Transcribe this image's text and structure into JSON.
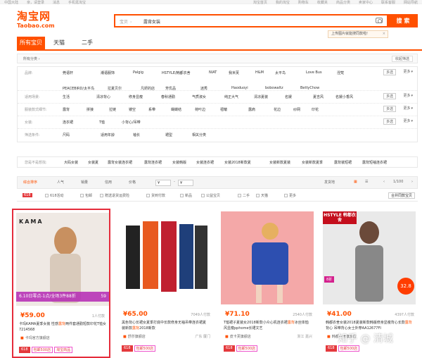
{
  "topbar": [
    "中国大陆",
    "亲，请登录",
    "消息",
    "手机逛淘宝",
    "",
    "淘宝首页",
    "我的淘宝",
    "购物车",
    "收藏夹",
    "商品分类",
    "卖家中心",
    "联系客服",
    "网站导航"
  ],
  "logo": {
    "cn": "淘宝网",
    "en": "Taobao.com"
  },
  "search": {
    "category": "宝贝",
    "query": "露背女装",
    "button": "搜 索",
    "camera": "camera-icon",
    "tip": "上传图片就能搜同款啦!",
    "tip_close": "×"
  },
  "tabs": [
    "所有宝贝",
    "天猫",
    "二手"
  ],
  "crumb": "所有分类",
  "collapse": "收起筛选",
  "filters": [
    {
      "label": "品牌:",
      "values": [
        "莞语轩",
        "潮语服饰",
        "Palgig",
        "HSTYLE/韩都衣舍",
        "NIAT",
        "我米芙",
        "H&M",
        "太平鸟",
        "Love Bus",
        "涅梵",
        "PEACEBIRD/太平鸟",
        "拉夏贝尔",
        "凡妍的店",
        "芳优品",
        "迷秀",
        "Haoduoyi",
        "bobowaltz",
        "BettyChow"
      ],
      "multi": "多选",
      "more": "更多"
    },
    {
      "label": "适用场景:",
      "values": [
        "生活",
        "清凉背心",
        "修身显瘦",
        "春秋通勤",
        "气质淑女",
        "纯正大气",
        "清凉夏装",
        "名媛",
        "夏吉风",
        "名媛小香风"
      ],
      "multi": "多选",
      "more": "更多"
    },
    {
      "label": "服装款式细节:",
      "values": [
        "露背",
        "拼接",
        "拉链",
        "镂空",
        "系带",
        "蝴蝶结",
        "荷叶边",
        "褶皱",
        "露肩",
        "花边",
        "纱网",
        "印花"
      ],
      "multi": "多选",
      "more": "更多"
    },
    {
      "label": "女装:",
      "values": [
        "连衣裙",
        "T恤",
        "小背心/吊带"
      ],
      "multi": "多选",
      "more": "更多"
    },
    {
      "label": "筛选条件:",
      "values": [
        "尺码",
        "适用年龄",
        "袖长",
        "裙型",
        "相关分类"
      ]
    }
  ],
  "guess": {
    "label": "您是不是想找:",
    "values": [
      "大码女装",
      "女装夏",
      "露背女装连衣裙",
      "露背连衣裙",
      "女装韩版",
      "女装连衣裙",
      "女装2018新款夏",
      "女装新款夏装",
      "女装新款夏季",
      "露背装短裙",
      "露背短袖连衣裙",
      "露背",
      "外贸女装",
      "精品女装"
    ]
  },
  "sort": {
    "items": [
      "综合排序",
      "人气",
      "销量",
      "信用",
      "价格"
    ],
    "price_from": "¥",
    "price_to": "¥",
    "ship": "发货地",
    "pages": "1/100"
  },
  "opts": {
    "badge": "618",
    "items": [
      "618活动",
      "包邮",
      "赠送退货运费险",
      "货到付款",
      "新品",
      "公益宝贝",
      "二手",
      "天猫",
      "更多"
    ],
    "ship_to": "合并同款宝贝"
  },
  "products": [
    {
      "brand": "KAMA",
      "price": "¥59.00",
      "sold": "1人付款",
      "title_pre": "卡玛KAMA夏季女装 性感",
      "title_hi": "露背",
      "title_post": "两件套通勤短款印花T恤女 7214568",
      "promo": "6.10日零点-1点/全场3件88折",
      "promo_price": "59",
      "shop": "卡玛官方旗舰店",
      "loc": "",
      "tags": [
        "618",
        "包邮500店",
        "淘宝商品"
      ]
    },
    {
      "price": "¥65.00",
      "sold": "7049人付款",
      "title_pre": "黑色背心长裙女夏季打底中长款修身无袖吊带连衣裙夏装新款",
      "title_hi": "露背",
      "title_post": "2018新款",
      "shop": "舒莎旗舰店",
      "loc": "广东 厦门",
      "tags": [
        "618",
        "包邮500店"
      ]
    },
    {
      "price": "¥71.10",
      "sold": "2540人付款",
      "title_pre": "T恤裙子夏装女2018新款小众心机连衣裙",
      "title_hi": "露背",
      "title_post": "冰丝体恤风显瘦pphome长裙文艺",
      "shop": "皮卡芙旗舰店",
      "loc": "浙江 嘉兴",
      "tags": [
        "618",
        "包邮500店"
      ]
    },
    {
      "brand": "HSTYLE 韩都衣舍",
      "price": "¥41.00",
      "sold": "4397人付款",
      "title_pre": "韩都衣舍女装2018夏装新款韩版修身显瘦背心长款",
      "title_hi": "露背",
      "title_post": "背心 吊带背心女士外穿AA12677FI",
      "promo": "8折",
      "promo_price": "32.8",
      "shop": "韩都衣舍旗舰店",
      "loc": "",
      "tags": [
        "618",
        "包邮500店"
      ]
    }
  ],
  "watermark": "知乎 @ 清城"
}
